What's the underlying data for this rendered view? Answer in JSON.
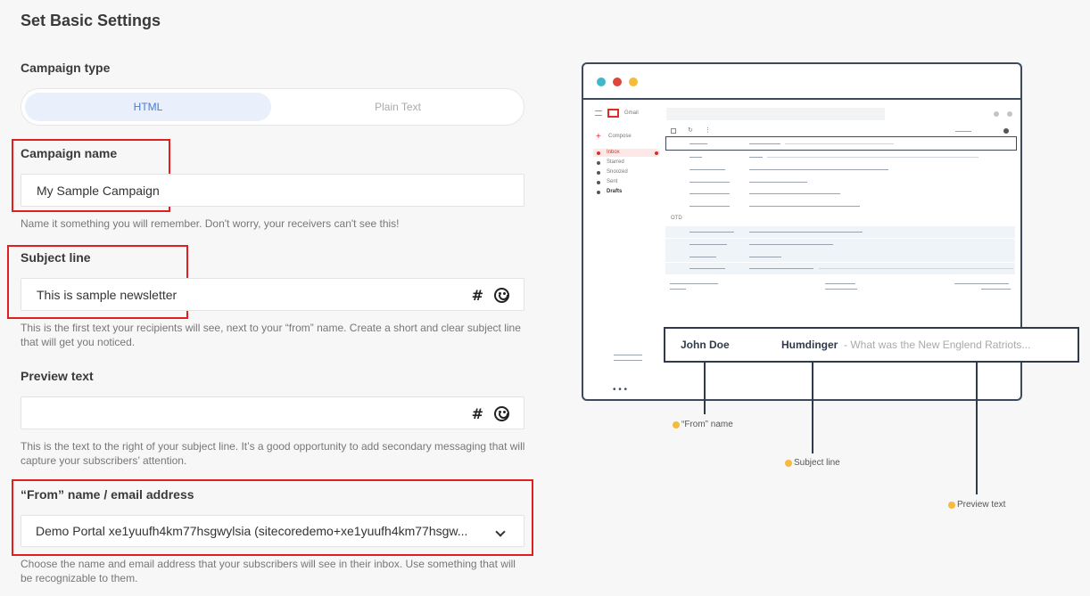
{
  "page": {
    "title": "Set Basic Settings"
  },
  "campaign_type": {
    "label": "Campaign type",
    "options": [
      "HTML",
      "Plain Text"
    ],
    "selected": "HTML"
  },
  "campaign_name": {
    "label": "Campaign name",
    "value": "My Sample Campaign",
    "helper": "Name it something you will remember. Don't worry, your receivers can't see this!"
  },
  "subject_line": {
    "label": "Subject line",
    "value": "This is sample newsletter",
    "helper": "This is the first text your recipients will see, next to your “from” name. Create a short and clear subject line that will get you noticed."
  },
  "preview_text": {
    "label": "Preview text",
    "value": "",
    "helper": "This is the text to the right of your subject line. It’s a good opportunity to add secondary messaging that will capture your subscribers’ attention."
  },
  "from_name": {
    "label": "“From” name / email address",
    "value": "Demo Portal xe1yuufh4km77hsgwylsia (sitecoredemo+xe1yuufh4km77hsgw...",
    "helper": "Choose the name and email address that your subscribers will see in their inbox. Use something that will be recognizable to them."
  },
  "illustration": {
    "gmail_label": "Gmail",
    "compose_label": "Compose",
    "folders": [
      "Inbox",
      "Starred",
      "Snoozed",
      "Sent",
      "Drafts"
    ],
    "section_label": "OTD",
    "sender": "John Doe",
    "subject": "Humdinger",
    "preview": " - What was the New Englend Ratriots...",
    "callout_from": "“From” name",
    "callout_subject": "Subject line",
    "callout_preview": "Preview text",
    "colors": {
      "dot1": "#3fb8c8",
      "dot2": "#e0453b",
      "dot3": "#f4bb3c"
    }
  },
  "icons": {
    "hash": "#",
    "emoji": "smiley-icon"
  }
}
